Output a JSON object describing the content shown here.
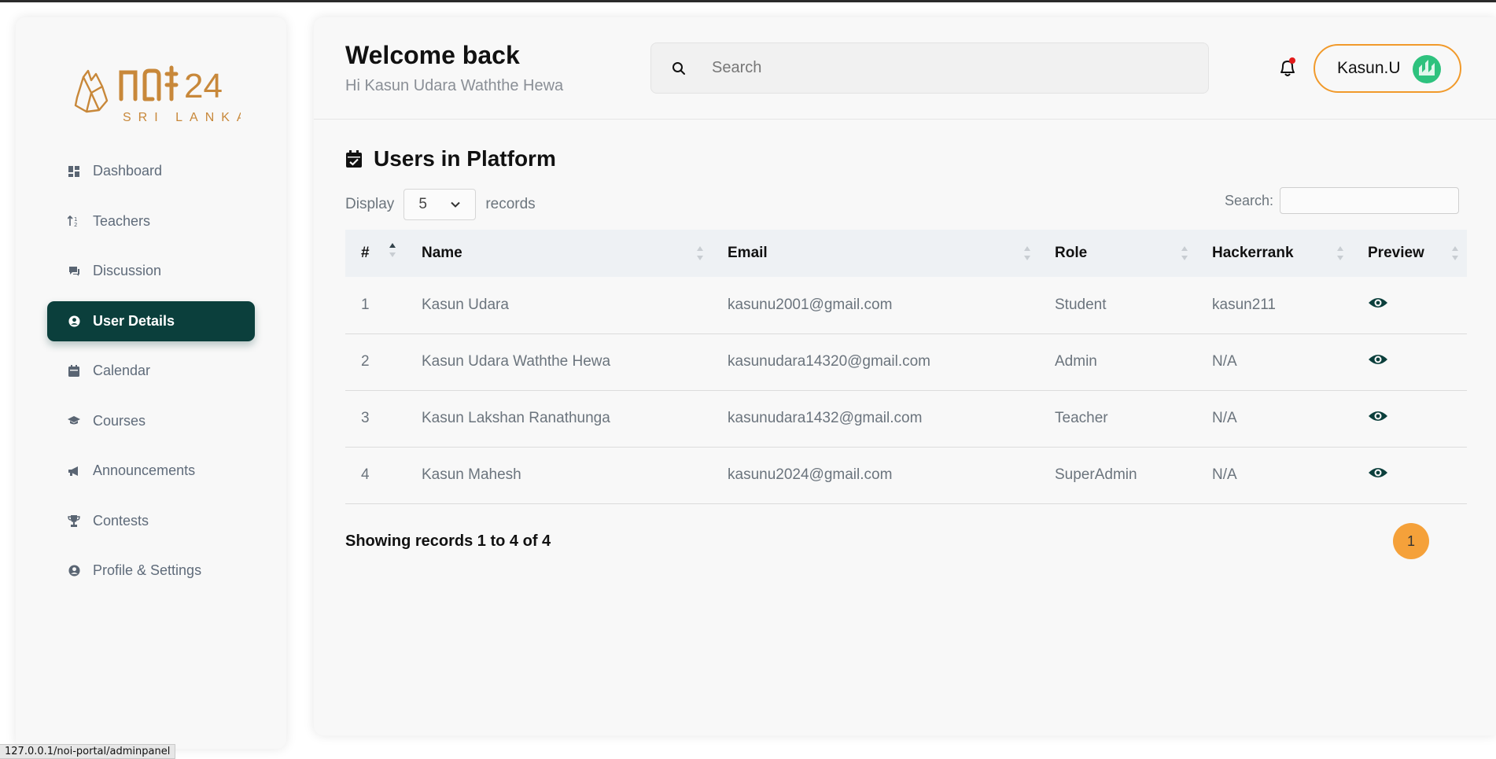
{
  "brand": {
    "logo_text": "NOI 24",
    "logo_subtitle": "SRI LANKA",
    "accent": "#c8883a"
  },
  "sidebar": {
    "items": [
      {
        "label": "Dashboard",
        "icon": "dashboard-icon",
        "active": false
      },
      {
        "label": "Teachers",
        "icon": "sort-icon",
        "active": false
      },
      {
        "label": "Discussion",
        "icon": "chat-icon",
        "active": false
      },
      {
        "label": "User Details",
        "icon": "user-icon",
        "active": true
      },
      {
        "label": "Calendar",
        "icon": "calendar-icon",
        "active": false
      },
      {
        "label": "Courses",
        "icon": "graduation-cap-icon",
        "active": false
      },
      {
        "label": "Announcements",
        "icon": "megaphone-icon",
        "active": false
      },
      {
        "label": "Contests",
        "icon": "trophy-icon",
        "active": false
      },
      {
        "label": "Profile & Settings",
        "icon": "user-icon",
        "active": false
      }
    ],
    "active_color": "#0b3f3c"
  },
  "header": {
    "title": "Welcome back",
    "subtitle": "Hi Kasun Udara Waththe Hewa",
    "search_placeholder": "Search",
    "user_name": "Kasun.U"
  },
  "content": {
    "title": "Users in Platform",
    "display_label": "Display",
    "display_value": "5",
    "records_label": "records",
    "search_label": "Search:",
    "columns": [
      "#",
      "Name",
      "Email",
      "Role",
      "Hackerrank",
      "Preview"
    ],
    "rows": [
      {
        "index": "1",
        "name": "Kasun Udara",
        "email": "kasunu2001@gmail.com",
        "role": "Student",
        "hackerrank": "kasun211"
      },
      {
        "index": "2",
        "name": "Kasun Udara Waththe Hewa",
        "email": "kasunudara14320@gmail.com",
        "role": "Admin",
        "hackerrank": "N/A"
      },
      {
        "index": "3",
        "name": "Kasun Lakshan Ranathunga",
        "email": "kasunudara1432@gmail.com",
        "role": "Teacher",
        "hackerrank": "N/A"
      },
      {
        "index": "4",
        "name": "Kasun Mahesh",
        "email": "kasunu2024@gmail.com",
        "role": "SuperAdmin",
        "hackerrank": "N/A"
      }
    ],
    "showing_text": "Showing records 1 to 4 of 4",
    "current_page": "1",
    "page_color": "#f5a13a"
  },
  "status_bar": {
    "url": "127.0.0.1/noi-portal/adminpanel"
  }
}
